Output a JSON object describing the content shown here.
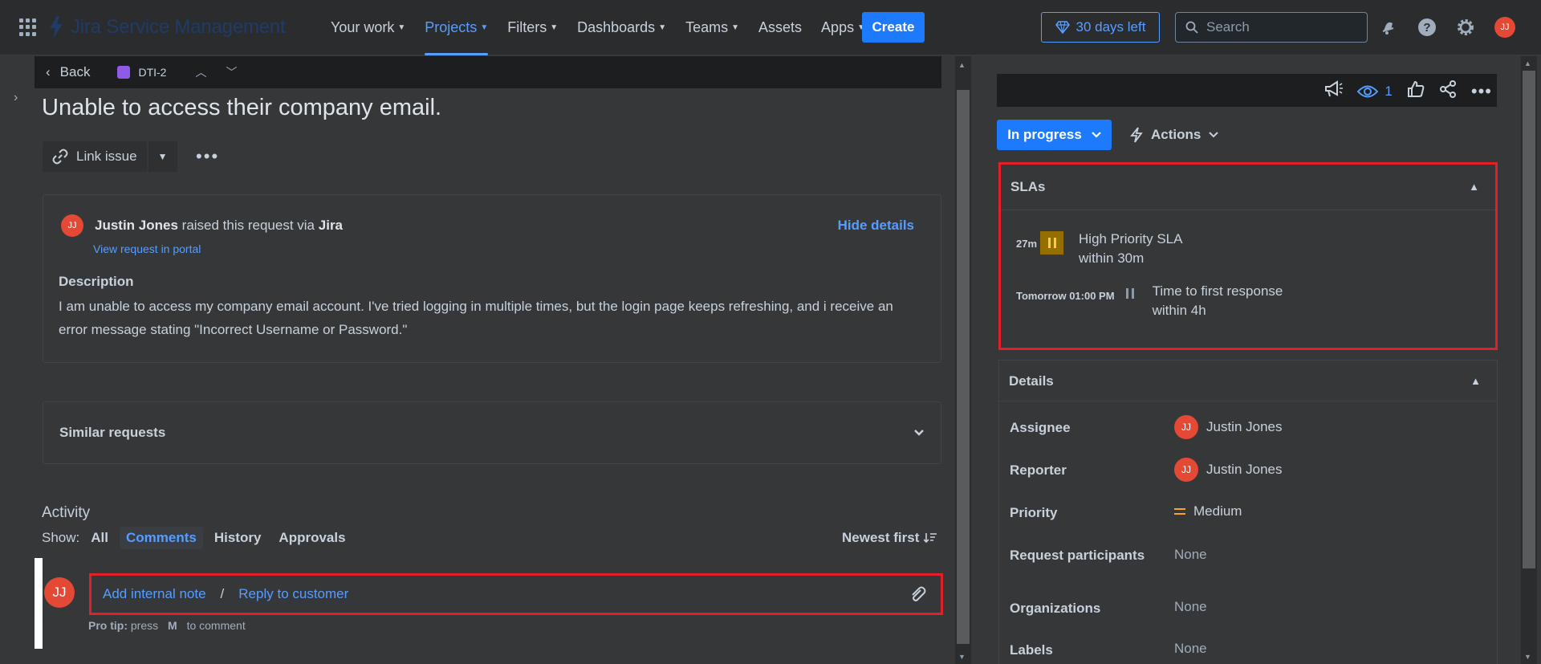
{
  "topbar": {
    "product_name": "Jira Service Management",
    "nav": [
      "Your work",
      "Projects",
      "Filters",
      "Dashboards",
      "Teams",
      "Assets",
      "Apps"
    ],
    "create_label": "Create",
    "trial_label": "30 days left",
    "search_placeholder": "Search",
    "user_initials": "JJ"
  },
  "issue": {
    "back_label": "Back",
    "key": "DTI-2",
    "title": "Unable to access their company email.",
    "link_issue_label": "Link issue",
    "reporter": "Justin Jones",
    "raised_via_text": "raised this request via",
    "raised_via_channel": "Jira",
    "view_portal_label": "View request in portal",
    "hide_details_label": "Hide details",
    "description_heading": "Description",
    "description": "I am unable to access my company email account. I've tried logging in multiple times, but the login page keeps refreshing, and i  receive an error message stating \"Incorrect Username or Password.\"",
    "similar_requests_label": "Similar requests"
  },
  "activity": {
    "heading": "Activity",
    "show_label": "Show:",
    "filters": [
      "All",
      "Comments",
      "History",
      "Approvals"
    ],
    "selected_filter": "Comments",
    "sort_label": "Newest first",
    "commenter_initials": "JJ",
    "add_internal_note": "Add internal note",
    "separator": "/",
    "reply_to_customer": "Reply to customer",
    "pro_tip_label": "Pro tip:",
    "pro_tip_press": "press",
    "pro_tip_key": "M",
    "pro_tip_suffix": "to comment"
  },
  "panel": {
    "watchers_count": "1",
    "status": "In progress",
    "actions_label": "Actions",
    "slas_heading": "SLAs",
    "slas": [
      {
        "time": "27m",
        "name": "High Priority SLA",
        "target": "within 30m"
      },
      {
        "time": "Tomorrow 01:00 PM",
        "name": "Time to first response",
        "target": "within 4h"
      }
    ],
    "details_heading": "Details",
    "fields": {
      "assignee_label": "Assignee",
      "assignee": "Justin Jones",
      "assignee_initials": "JJ",
      "reporter_label": "Reporter",
      "reporter": "Justin Jones",
      "reporter_initials": "JJ",
      "priority_label": "Priority",
      "priority": "Medium",
      "participants_label": "Request participants",
      "participants": "None",
      "organizations_label": "Organizations",
      "organizations": "None",
      "labels_label": "Labels",
      "labels": "None"
    }
  },
  "colors": {
    "accent": "#579dff",
    "primary_button": "#1d7afc",
    "highlight_border": "#e2202a",
    "avatar": "#e34935",
    "sla_paused": "#946f00",
    "priority_medium": "#f5a623"
  }
}
